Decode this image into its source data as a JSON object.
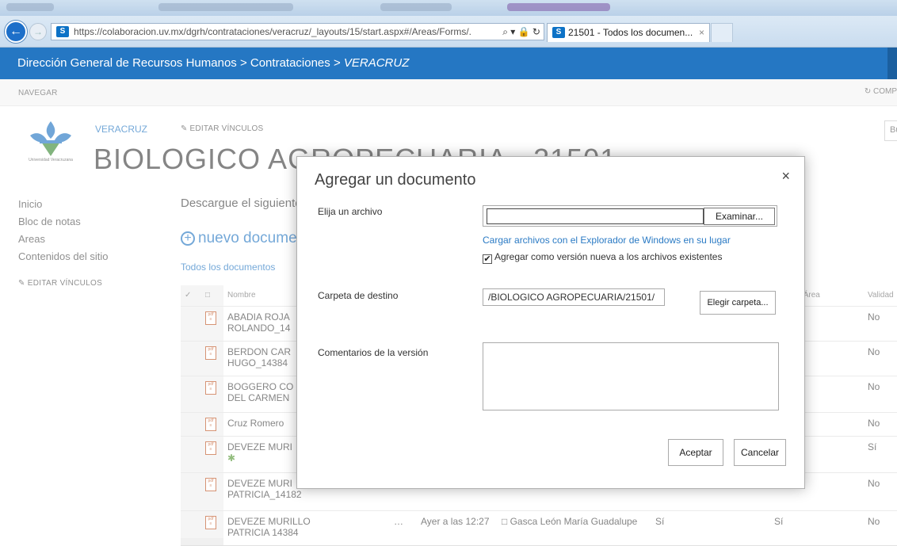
{
  "browser": {
    "url": "https://colaboracion.uv.mx/dgrh/contrataciones/veracruz/_layouts/15/start.aspx#/Areas/Forms/.",
    "url_icons": "⌕ ▾ 🔒 ↻",
    "tab_title": "21501 - Todos los documen...",
    "tab_close": "×",
    "favicon": "S"
  },
  "suitebar": {
    "crumb": "Dirección General de Recursos Humanos > Contrataciones > ",
    "crumb_current": "VERACRUZ"
  },
  "navbar": {
    "label": "NAVEGAR",
    "sync": "↻ COMP"
  },
  "header": {
    "logo_caption": "Universidad Veracruzana",
    "site_link": "VERACRUZ",
    "edit_links": "✎  EDITAR VÍNCULOS",
    "title": "BIOLOGICO AGROPECUARIA - 21501",
    "search": "Bu"
  },
  "leftnav": {
    "items": [
      "Inicio",
      "Bloc de notas",
      "Areas",
      "Contenidos del sitio"
    ],
    "edit": "✎  EDITAR VÍNCULOS"
  },
  "main": {
    "description": "Descargue el siguiente formato",
    "new_doc": "nuevo documento",
    "new_doc_icon": "+",
    "all_docs": "Todos los documentos"
  },
  "table": {
    "headers": [
      "✓",
      "□",
      "Nombre",
      "",
      "",
      "",
      "",
      "ado por Área",
      "Validad"
    ],
    "rows": [
      {
        "name1": "ABADIA ROJA",
        "name2": "ROLANDO_14",
        "dots": "",
        "modified": "",
        "by": "",
        "c1": "",
        "c2": "",
        "valid": "No"
      },
      {
        "name1": "BERDON CAR",
        "name2": "HUGO_14384",
        "dots": "",
        "modified": "",
        "by": "",
        "c1": "",
        "c2": "",
        "valid": "No"
      },
      {
        "name1": "BOGGERO CO",
        "name2": "DEL CARMEN",
        "dots": "",
        "modified": "",
        "by": "",
        "c1": "",
        "c2": "",
        "valid": "No"
      },
      {
        "name1": "Cruz Romero",
        "name2": "",
        "dots": "",
        "modified": "",
        "by": "",
        "c1": "",
        "c2": "",
        "valid": "No"
      },
      {
        "name1": "DEVEZE MURI",
        "name2": "✱",
        "dots": "",
        "modified": "",
        "by": "",
        "c1": "",
        "c2": "",
        "valid": "Sí"
      },
      {
        "name1": "DEVEZE MURI",
        "name2": "PATRICIA_14182",
        "dots": "",
        "modified": "",
        "by": "",
        "c1": "",
        "c2": "",
        "valid": "No"
      },
      {
        "name1": "DEVEZE MURILLO",
        "name2": "PATRICIA 14384",
        "dots": "…",
        "modified": "Ayer a las 12:27",
        "by": "□ Gasca León María Guadalupe",
        "c1": "Sí",
        "c2": "Sí",
        "valid": "No"
      }
    ]
  },
  "dialog": {
    "title": "Agregar un documento",
    "close": "×",
    "choose_file_label": "Elija un archivo",
    "browse_button": "Examinar...",
    "upload_link": "Cargar archivos con el Explorador de Windows en su lugar",
    "overwrite_checked": "✔",
    "overwrite_label": "Agregar como versión nueva a los archivos existentes",
    "dest_label": "Carpeta de destino",
    "dest_value": "/BIOLOGICO AGROPECUARIA/21501/",
    "choose_folder": "Elegir carpeta...",
    "comments_label": "Comentarios de la versión",
    "comments_value": "",
    "ok": "Aceptar",
    "cancel": "Cancelar"
  },
  "colors": {
    "suite_blue": "#2577c3",
    "link_blue": "#2a7ac4"
  }
}
